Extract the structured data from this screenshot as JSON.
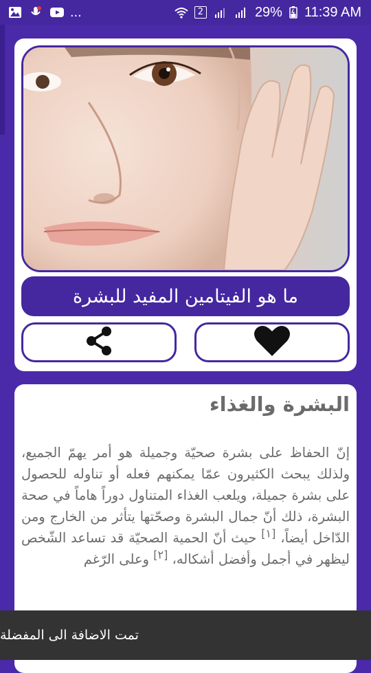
{
  "status_bar": {
    "time": "11:39 AM",
    "battery": "29%",
    "sim_badge": "2",
    "more_notifications": "...",
    "icons": [
      "image-icon",
      "mic-icon",
      "youtube-icon",
      "wifi-icon",
      "signal-icon",
      "signal-icon-2",
      "battery-icon"
    ]
  },
  "hero": {
    "title": "ما هو الفيتامين المفيد للبشرة",
    "image_icon": "face-photo"
  },
  "actions": {
    "share_icon": "share-icon",
    "favorite_icon": "heart-icon"
  },
  "article": {
    "heading": "البشرة والغذاء",
    "paragraph1": "إنّ الحفاظ على بشرة صحيّة وجميلة هو أمر يهمّ الجميع، ولذلك يبحث الكثيرون عمّا يمكنهم فعله أو تناوله للحصول على بشرة جميلة، ويلعب الغذاء المتناول دوراً هاماً في صحة البشرة، ذلك أنّ جمال البشرة وصحّتها يتأثر من الخارج ومن الدّاخل أيضاً،",
    "ref1": "[١]",
    "paragraph2": "حيث أنّ الحمية الصحيّة قد تساعد الشّخص ليظهر في أجمل وأفضل أشكاله،",
    "ref2": "[٢]",
    "paragraph3": "وعلى الرّغم"
  },
  "toast": {
    "message": "تمت الاضافة الى المفضلة"
  },
  "colors": {
    "primary": "#4527a0",
    "background": "#4a2aa8",
    "toast": "#333333",
    "text": "#6b6b6b"
  }
}
